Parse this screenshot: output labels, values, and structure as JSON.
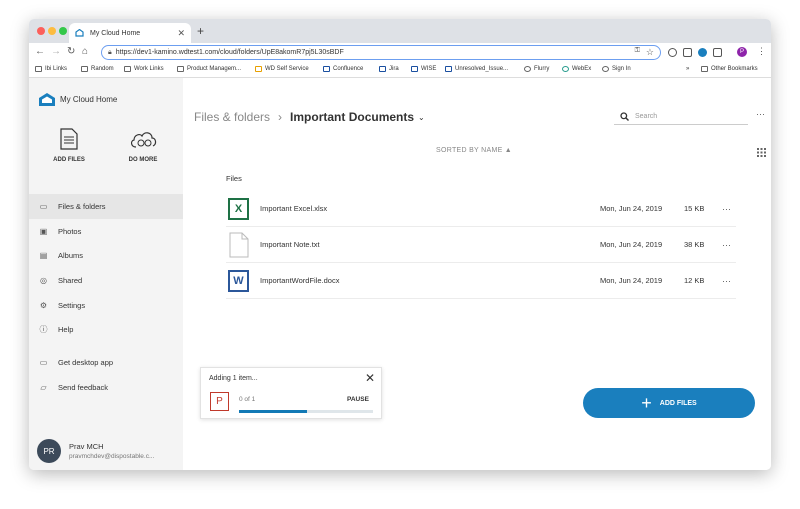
{
  "browser": {
    "tab_title": "My Cloud Home",
    "url": "https://dev1-kamino.wdtest1.com/cloud/folders/UpE8akomR7pj5L30sBDF",
    "bookmarks": [
      "Ibi Links",
      "Random",
      "Work Links",
      "Product Managem...",
      "WD Self Service",
      "Confluence",
      "Jira",
      "WISE",
      "Unresolved_Issue...",
      "Flurry",
      "WebEx",
      "Sign In",
      "»",
      "Other Bookmarks"
    ],
    "profile_initial": "P"
  },
  "app": {
    "name": "My Cloud Home",
    "quick_actions": {
      "add_files": "ADD FILES",
      "do_more": "DO MORE"
    },
    "nav": [
      {
        "label": "Files & folders",
        "icon": "folder-icon"
      },
      {
        "label": "Photos",
        "icon": "photo-icon"
      },
      {
        "label": "Albums",
        "icon": "album-icon"
      },
      {
        "label": "Shared",
        "icon": "shared-icon"
      },
      {
        "label": "Settings",
        "icon": "settings-icon"
      },
      {
        "label": "Help",
        "icon": "help-icon"
      },
      {
        "label": "Get desktop app",
        "icon": "desktop-icon"
      },
      {
        "label": "Send feedback",
        "icon": "feedback-icon"
      }
    ],
    "user": {
      "initials": "PR",
      "name": "Prav MCH",
      "email": "pravmchdev@dispostable.c..."
    }
  },
  "main": {
    "breadcrumb_root": "Files & folders",
    "breadcrumb_sep": "›",
    "current_folder": "Important Documents",
    "search_placeholder": "Search",
    "sorted_label": "SORTED BY NAME ▲",
    "files_heading": "Files",
    "files": [
      {
        "icon": "X",
        "name": "Important Excel.xlsx",
        "date": "Mon, Jun 24, 2019",
        "size": "15 KB",
        "type": "excel"
      },
      {
        "icon": "",
        "name": "Important Note.txt",
        "date": "Mon, Jun 24, 2019",
        "size": "38 KB",
        "type": "text"
      },
      {
        "icon": "W",
        "name": "ImportantWordFile.docx",
        "date": "Mon, Jun 24, 2019",
        "size": "12 KB",
        "type": "word"
      }
    ],
    "more_glyph": "···"
  },
  "upload": {
    "title": "Adding 1 item...",
    "file_icon": "P",
    "count": "0 of 1",
    "pause_label": "PAUSE",
    "progress": 0.51
  },
  "fab": {
    "label": "ADD FILES"
  },
  "colors": {
    "accent": "#1a7fbe",
    "excel": "#1e7145",
    "word": "#2b579a",
    "ppt": "#c0392b",
    "progress": "#1279b5"
  }
}
